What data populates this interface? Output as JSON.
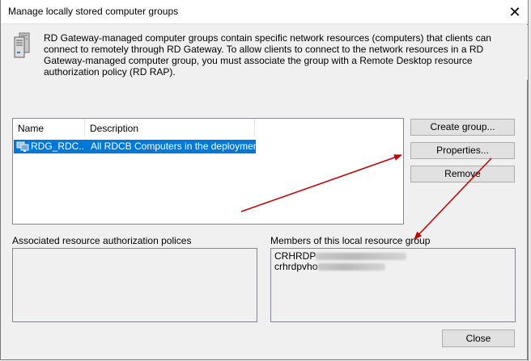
{
  "window": {
    "title": "Manage locally stored computer groups",
    "close_glyph": "✕"
  },
  "intro": {
    "text": "RD Gateway-managed computer groups contain specific network resources (computers) that clients can connect to remotely through RD Gateway. To allow clients to connect to the network resources in a RD Gateway-managed computer group, you must associate the group with a Remote Desktop resource authorization policy (RD RAP).",
    "icon": "server-icon"
  },
  "groups_list": {
    "columns": [
      "Name",
      "Description"
    ],
    "rows": [
      {
        "name": "RDG_RDC...",
        "description": "All RDCB Computers in the deployment",
        "selected": true,
        "icon": "computer-group-icon"
      }
    ]
  },
  "buttons": {
    "create": "Create group...",
    "properties": "Properties...",
    "remove": "Remove",
    "close": "Close"
  },
  "associated": {
    "label": "Associated resource authorization polices"
  },
  "members": {
    "label": "Members of this local resource group",
    "items": [
      "CRHRDP",
      "crhrdpvho"
    ]
  },
  "colors": {
    "selection": "#0078d7",
    "arrow": "#c00000"
  }
}
